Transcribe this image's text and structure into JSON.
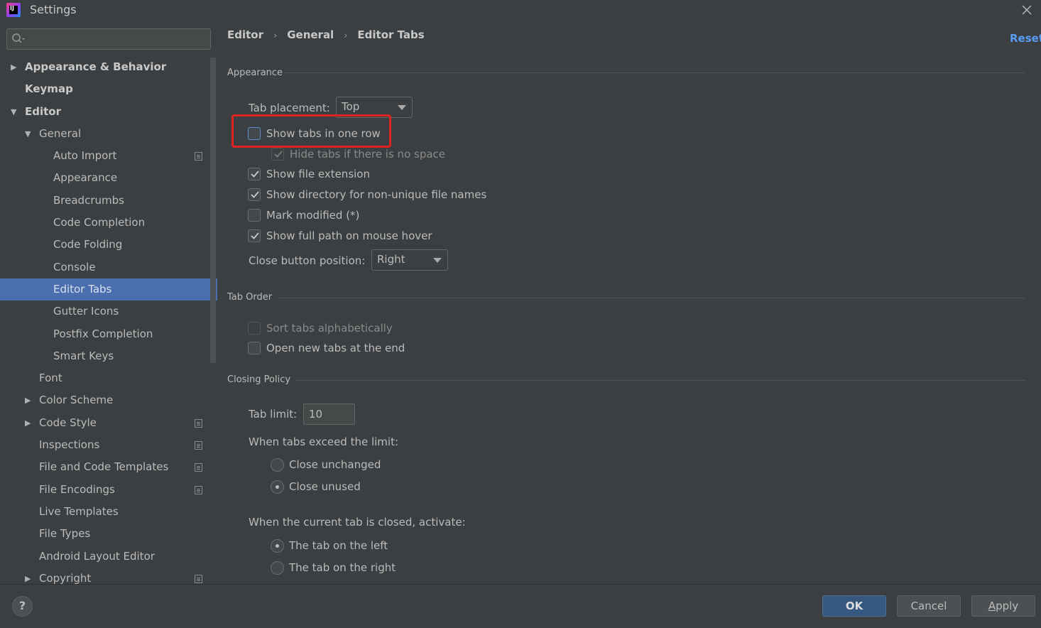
{
  "window": {
    "title": "Settings",
    "logo_text": "IJ"
  },
  "search": {
    "placeholder": "",
    "value": ""
  },
  "sidebar": {
    "items": [
      {
        "label": "Appearance & Behavior",
        "bold": true,
        "arrow": "collapsed",
        "project": false
      },
      {
        "label": "Keymap",
        "bold": true,
        "arrow": "none",
        "project": false
      },
      {
        "label": "Editor",
        "bold": true,
        "arrow": "expanded",
        "project": false
      },
      {
        "label": "General",
        "bold": false,
        "arrow": "expanded",
        "project": false
      },
      {
        "label": "Auto Import",
        "bold": false,
        "arrow": "none",
        "project": true
      },
      {
        "label": "Appearance",
        "bold": false,
        "arrow": "none",
        "project": false
      },
      {
        "label": "Breadcrumbs",
        "bold": false,
        "arrow": "none",
        "project": false
      },
      {
        "label": "Code Completion",
        "bold": false,
        "arrow": "none",
        "project": false
      },
      {
        "label": "Code Folding",
        "bold": false,
        "arrow": "none",
        "project": false
      },
      {
        "label": "Console",
        "bold": false,
        "arrow": "none",
        "project": false
      },
      {
        "label": "Editor Tabs",
        "bold": false,
        "arrow": "none",
        "project": false,
        "selected": true
      },
      {
        "label": "Gutter Icons",
        "bold": false,
        "arrow": "none",
        "project": false
      },
      {
        "label": "Postfix Completion",
        "bold": false,
        "arrow": "none",
        "project": false
      },
      {
        "label": "Smart Keys",
        "bold": false,
        "arrow": "none",
        "project": false
      },
      {
        "label": "Font",
        "bold": false,
        "arrow": "none",
        "project": false
      },
      {
        "label": "Color Scheme",
        "bold": false,
        "arrow": "collapsed",
        "project": false
      },
      {
        "label": "Code Style",
        "bold": false,
        "arrow": "collapsed",
        "project": true
      },
      {
        "label": "Inspections",
        "bold": false,
        "arrow": "none",
        "project": true
      },
      {
        "label": "File and Code Templates",
        "bold": false,
        "arrow": "none",
        "project": true
      },
      {
        "label": "File Encodings",
        "bold": false,
        "arrow": "none",
        "project": true
      },
      {
        "label": "Live Templates",
        "bold": false,
        "arrow": "none",
        "project": false
      },
      {
        "label": "File Types",
        "bold": false,
        "arrow": "none",
        "project": false
      },
      {
        "label": "Android Layout Editor",
        "bold": false,
        "arrow": "none",
        "project": false
      },
      {
        "label": "Copyright",
        "bold": false,
        "arrow": "collapsed",
        "project": true
      }
    ]
  },
  "breadcrumb": {
    "part1": "Editor",
    "part2": "General",
    "part3": "Editor Tabs",
    "separator": "›"
  },
  "reset_label": "Reset",
  "appearance": {
    "section_title": "Appearance",
    "tab_placement_label": "Tab placement:",
    "tab_placement_value": "Top",
    "show_one_row": {
      "label": "Show tabs in one row",
      "checked": false
    },
    "hide_no_space": {
      "label": "Hide tabs if there is no space",
      "checked": true,
      "disabled": true
    },
    "show_extension": {
      "label": "Show file extension",
      "checked": true
    },
    "show_directory": {
      "label": "Show directory for non-unique file names",
      "checked": true
    },
    "mark_modified": {
      "label": "Mark modified (*)",
      "checked": false
    },
    "show_full_path": {
      "label": "Show full path on mouse hover",
      "checked": true
    },
    "close_button_label": "Close button position:",
    "close_button_value": "Right"
  },
  "tab_order": {
    "section_title": "Tab Order",
    "sort_alpha": {
      "label": "Sort tabs alphabetically",
      "checked": false,
      "disabled": true
    },
    "open_at_end": {
      "label": "Open new tabs at the end",
      "checked": false
    }
  },
  "closing_policy": {
    "section_title": "Closing Policy",
    "tab_limit_label": "Tab limit:",
    "tab_limit_value": "10",
    "exceed_label": "When tabs exceed the limit:",
    "close_unchanged": {
      "label": "Close unchanged",
      "selected": false
    },
    "close_unused": {
      "label": "Close unused",
      "selected": true
    },
    "activate_label": "When the current tab is closed, activate:",
    "tab_left": {
      "label": "The tab on the left",
      "selected": true
    },
    "tab_right": {
      "label": "The tab on the right",
      "selected": false
    }
  },
  "footer": {
    "help_label": "?",
    "ok_label": "OK",
    "cancel_label": "Cancel",
    "apply_mnemonic": "A",
    "apply_rest": "pply"
  },
  "colors": {
    "background": "#3c3f41",
    "selection": "#4b6eaf",
    "link": "#589df6",
    "highlight_border": "#e0231f",
    "primary_button": "#365880"
  }
}
